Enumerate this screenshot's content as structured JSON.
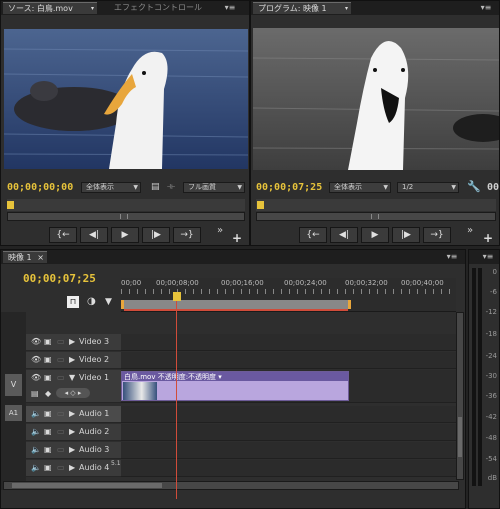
{
  "source_panel": {
    "tab_source": "ソース: 白鳥.mov",
    "tab_effect": "エフェクトコントロール",
    "timecode": "00;00;00;00",
    "zoom_select": "全体表示",
    "quality_select": "フル画質"
  },
  "program_panel": {
    "tab_program": "プログラム: 映像 1",
    "timecode": "00;00;07;25",
    "zoom_select": "全体表示",
    "quality_select": "1/2",
    "right_value": "00"
  },
  "transport": {
    "mark_in": "{←",
    "step_back": "◀|",
    "play": "▶",
    "step_fwd": "|▶",
    "mark_out": "→}",
    "more": "»",
    "add": "+"
  },
  "timeline": {
    "tab": "映像 1",
    "timecode": "00;00;07;25",
    "ruler": [
      "00;00",
      "00;00;08;00",
      "00;00;16;00",
      "00;00;24;00",
      "00;00;32;00",
      "00;00;40;00"
    ],
    "v_target": "V",
    "a_target": "A1",
    "video_tracks": [
      "Video 3",
      "Video 2",
      "Video 1"
    ],
    "audio_tracks": [
      "Audio 1",
      "Audio 2",
      "Audio 3",
      "Audio 4"
    ],
    "audio4_badge": "5.1",
    "clip_label": "白鳥.mov  不透明度:不透明度 ▾"
  },
  "meter": {
    "labels": [
      "0",
      "-6",
      "-12",
      "-18",
      "-24",
      "-30",
      "-36",
      "-42",
      "-48",
      "-54",
      "dB"
    ]
  },
  "colors": {
    "timecode_yellow": "#e7c33b",
    "clip_purple": "#b9a6de",
    "playhead_red": "#d04c3a"
  }
}
